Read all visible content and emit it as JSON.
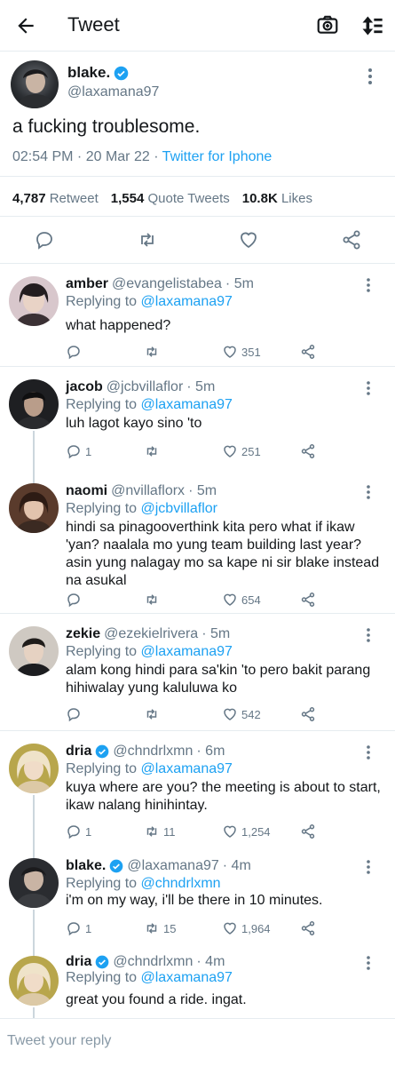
{
  "header": {
    "title": "Tweet"
  },
  "tweet": {
    "name": "blake.",
    "handle": "@laxamana97",
    "text": "a fucking troublesome.",
    "time": "02:54 PM · 20 Mar 22 · ",
    "source": "Twitter for Iphone",
    "stats": {
      "retweets": "4,787",
      "retweets_label": "Retweet",
      "quotes": "1,554",
      "quotes_label": "Quote Tweets",
      "likes": "10.8K",
      "likes_label": "Likes"
    }
  },
  "replies": [
    {
      "name": "amber",
      "handle": "@evangelistabea",
      "time": "· 5m",
      "replying_label": "Replying to ",
      "replying_to": "@laxamana97",
      "text": "what happened?",
      "replies": "",
      "retweets": "",
      "likes": "351"
    },
    {
      "name": "jacob",
      "handle": "@jcbvillaflor",
      "time": "· 5m",
      "replying_label": "Replying to ",
      "replying_to": "@laxamana97",
      "text": "luh lagot kayo sino 'to",
      "replies": "1",
      "retweets": "",
      "likes": "251"
    },
    {
      "name": "naomi",
      "handle": "@nvillaflorx",
      "time": "· 5m",
      "replying_label": "Replying to ",
      "replying_to": "@jcbvillaflor",
      "text": "hindi sa pinagooverthink kita pero what if ikaw 'yan? naalala mo yung team building last year? asin yung nalagay mo sa kape ni sir blake instead na asukal",
      "replies": "",
      "retweets": "",
      "likes": "654"
    },
    {
      "name": "zekie",
      "handle": "@ezekielrivera",
      "time": "· 5m",
      "replying_label": "Replying to ",
      "replying_to": "@laxamana97",
      "text": "alam kong hindi para sa'kin 'to pero bakit parang hihiwalay yung kaluluwa ko",
      "replies": "",
      "retweets": "",
      "likes": "542"
    },
    {
      "name": "dria",
      "handle": "@chndrlxmn",
      "time": "· 6m",
      "replying_label": "Replying to ",
      "replying_to": "@laxamana97",
      "text": "kuya where are you? the meeting is about to start, ikaw nalang hinihintay.",
      "replies": "1",
      "retweets": "11",
      "likes": "1,254"
    },
    {
      "name": "blake.",
      "handle": "@laxamana97",
      "time": "· 4m",
      "replying_label": "Replying to ",
      "replying_to": "@chndrlxmn",
      "text": "i'm on my way, i'll be there in 10 minutes.",
      "replies": "1",
      "retweets": "15",
      "likes": "1,964"
    },
    {
      "name": "dria",
      "handle": "@chndrlxmn",
      "time": "· 4m",
      "replying_label": "Replying to ",
      "replying_to": "@laxamana97",
      "text": "great you found a ride. ingat.",
      "replies": "",
      "retweets": "",
      "likes": ""
    }
  ],
  "composer": {
    "placeholder": "Tweet your reply"
  },
  "colors": {
    "accent": "#1da1f2",
    "muted": "#657786",
    "text": "#14171a",
    "divider": "#e6ecf0"
  }
}
